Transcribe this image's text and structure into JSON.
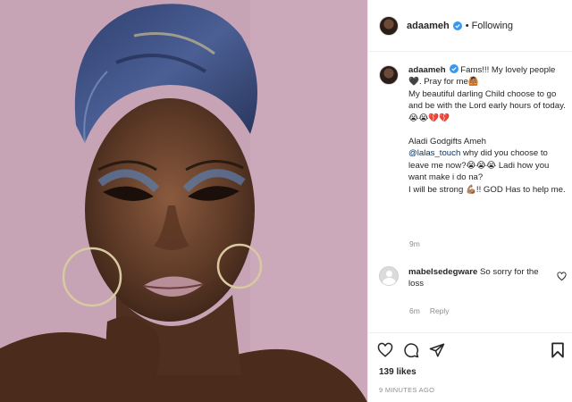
{
  "post": {
    "username": "adaameh",
    "follow_label": "Following",
    "separator": "•",
    "caption_lines": [
      "Fams!!! My lovely people 🖤. Pray for me🙆🏽",
      "My beautiful darling Child choose to go and be with the Lord early hours of today.😭😭💔💔",
      "",
      "Aladi Godgifts Ameh",
      "why did you choose to leave me now?😭😭😭 Ladi how you want make i do na?",
      "I will be strong 💪🏽!! GOD Has to help me."
    ],
    "caption_first_line": "Fams!!! My lovely people 🖤. Pray for me🙆🏽",
    "caption_line2": "My beautiful darling Child choose to go and be with the Lord early hours of today.😭😭💔💔",
    "caption_line3": "Aladi Godgifts Ameh",
    "caption_mention": "@lalas_touch",
    "caption_line4": " why did you choose to leave me now?😭😭😭 Ladi how you want make i do na?",
    "caption_line5": "I will be strong 💪🏽!! GOD Has to help me.",
    "caption_time": "9m",
    "likes": "139 likes",
    "time_ago": "9 MINUTES AGO"
  },
  "comment": {
    "username": "mabelsedegware",
    "text": " So sorry for the loss",
    "time": "6m",
    "reply_label": "Reply"
  },
  "icons": {
    "verified": "verified-badge-icon",
    "like": "heart-icon",
    "comment": "comment-icon",
    "share": "share-icon",
    "save": "bookmark-icon",
    "comment_like": "heart-icon"
  },
  "colors": {
    "verified": "#3897f0",
    "mention": "#00376b",
    "muted": "#8e8e8e",
    "text": "#262626"
  }
}
